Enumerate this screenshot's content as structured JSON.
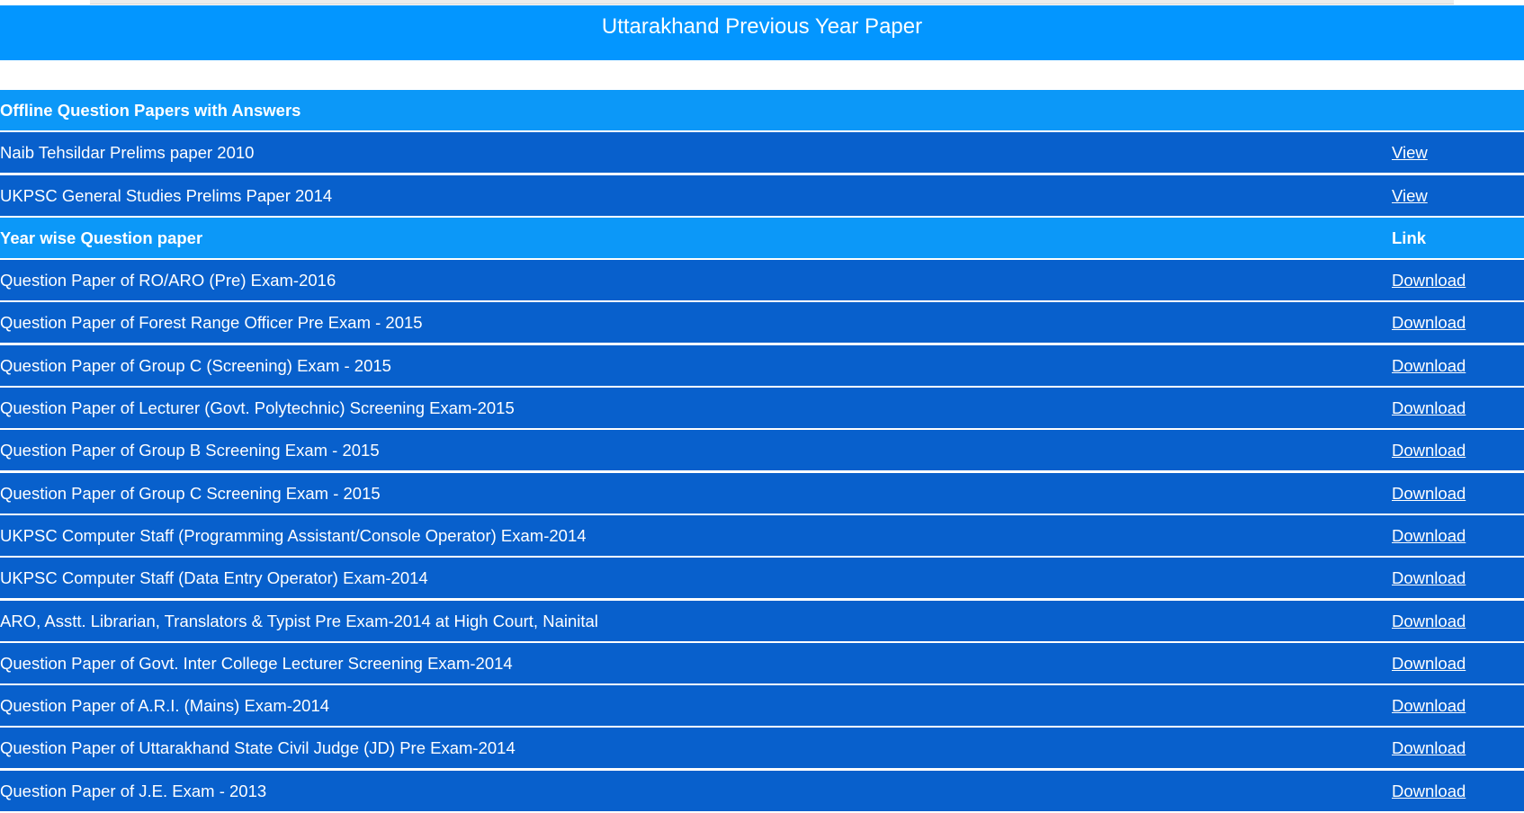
{
  "header": {
    "title": "Uttarakhand Previous Year Paper"
  },
  "rows": [
    {
      "type": "section",
      "label": "Offline Question Papers with Answers",
      "link": ""
    },
    {
      "type": "item",
      "label": "Naib Tehsildar Prelims paper 2010",
      "link": "View"
    },
    {
      "type": "item",
      "label": "UKPSC General Studies Prelims Paper 2014",
      "link": "View"
    },
    {
      "type": "section",
      "label": "Year wise Question paper",
      "link": "Link"
    },
    {
      "type": "item",
      "label": "Question Paper of RO/ARO (Pre) Exam-2016",
      "link": "Download"
    },
    {
      "type": "item",
      "label": "Question Paper of Forest Range Officer Pre Exam - 2015",
      "link": "Download"
    },
    {
      "type": "item",
      "label": "Question Paper of Group C (Screening) Exam - 2015",
      "link": "Download"
    },
    {
      "type": "item",
      "label": "Question Paper of Lecturer (Govt. Polytechnic) Screening Exam-2015",
      "link": "Download"
    },
    {
      "type": "item",
      "label": "Question Paper of Group B Screening Exam - 2015",
      "link": "Download"
    },
    {
      "type": "item",
      "label": "Question Paper of Group C Screening Exam - 2015",
      "link": "Download"
    },
    {
      "type": "item",
      "label": "UKPSC Computer Staff (Programming Assistant/Console Operator) Exam-2014",
      "link": "Download"
    },
    {
      "type": "item",
      "label": "UKPSC Computer Staff (Data Entry Operator) Exam-2014",
      "link": "Download"
    },
    {
      "type": "item",
      "label": "ARO, Asstt. Librarian, Translators & Typist Pre Exam-2014 at High Court, Nainital",
      "link": "Download"
    },
    {
      "type": "item",
      "label": "Question Paper of Govt. Inter College Lecturer Screening Exam-2014",
      "link": "Download"
    },
    {
      "type": "item",
      "label": "Question Paper of A.R.I. (Mains) Exam-2014",
      "link": "Download"
    },
    {
      "type": "item",
      "label": "Question Paper of Uttarakhand State Civil Judge (JD) Pre Exam-2014",
      "link": "Download"
    },
    {
      "type": "item",
      "label": "Question Paper of J.E. Exam - 2013",
      "link": "Download"
    }
  ],
  "colors": {
    "header_blue": "#0396ff",
    "section_blue": "#0c98f8",
    "row_blue": "#0860cc"
  }
}
